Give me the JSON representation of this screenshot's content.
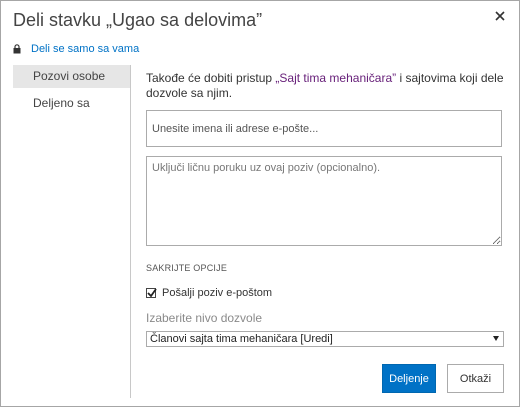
{
  "dialog": {
    "title": "Deli stavku „Ugao sa delovima”",
    "close_icon": "close-icon",
    "shared_only_with_you": "Deli se samo sa vama",
    "lock_icon": "lock-icon"
  },
  "sidebar": {
    "items": [
      {
        "label": "Pozovi osobe",
        "active": true
      },
      {
        "label": "Deljeno sa",
        "active": false
      }
    ]
  },
  "main": {
    "intro_prefix": "Takođe će dobiti pristup ",
    "intro_site": "„Sajt tima mehaničara”",
    "intro_suffix": " i sajtovima koji dele dozvole sa njim.",
    "names_placeholder": "Unesite imena ili adrese e-pošte...",
    "message_placeholder": "Uključi ličnu poruku uz ovaj poziv (opcionalno).",
    "hide_options": "SAKRIJTE OPCIJE",
    "send_email_label": "Pošalji poziv e-poštom",
    "send_email_checked": true,
    "permission_label": "Izaberite nivo dozvole",
    "permission_selected": "Članovi sajta tima mehaničara [Uredi]"
  },
  "buttons": {
    "share": "Deljenje",
    "cancel": "Otkaži"
  },
  "colors": {
    "accent": "#0072c6",
    "site_link": "#68217a"
  }
}
